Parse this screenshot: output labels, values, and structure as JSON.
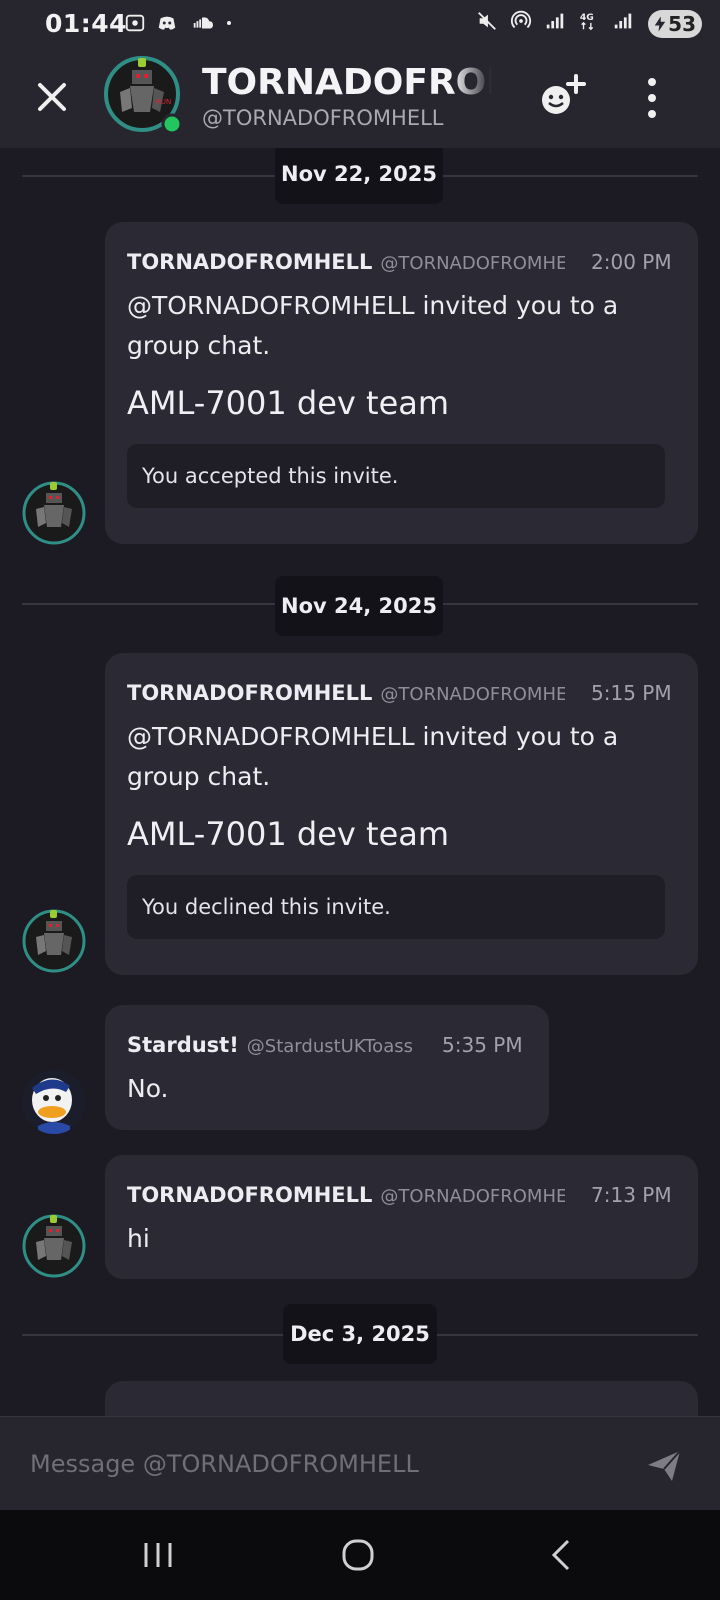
{
  "status_bar": {
    "time": "01:44",
    "battery": "53"
  },
  "header": {
    "title": "TORNADOFROMHELL",
    "subtitle": "@TORNADOFROMHELL"
  },
  "chat": {
    "date_dividers": [
      "Nov 22, 2025",
      "Nov 24, 2025",
      "Dec 3, 2025"
    ],
    "messages": [
      {
        "name": "TORNADOFROMHELL",
        "handle": "@TORNADOFROMHELL",
        "time": "2:00 PM",
        "text": "@TORNADOFROMHELL invited you to a group chat.",
        "group": "AML-7001 dev team",
        "invite_status": "You accepted this invite."
      },
      {
        "name": "TORNADOFROMHELL",
        "handle": "@TORNADOFROMHELL",
        "time": "5:15 PM",
        "text": "@TORNADOFROMHELL invited you to a group chat.",
        "group": "AML-7001 dev team",
        "invite_status": "You declined this invite."
      },
      {
        "name": "Stardust!",
        "handle": "@StardustUKToass",
        "time": "5:35 PM",
        "text": "No."
      },
      {
        "name": "TORNADOFROMHELL",
        "handle": "@TORNADOFROMHELL",
        "time": "7:13 PM",
        "text": "hi"
      }
    ]
  },
  "composer": {
    "placeholder": "Message @TORNADOFROMHELL"
  },
  "colors": {
    "background": "#1c1b24",
    "bubble": "#2b2a34",
    "online": "#23c55e",
    "avatar_ring": "#2f8f86"
  }
}
